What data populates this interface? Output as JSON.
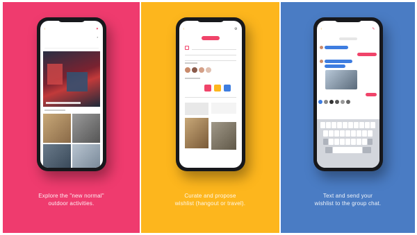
{
  "colors": {
    "panel_left": "#ef3b6e",
    "panel_middle": "#fdb61d",
    "panel_right": "#4a7cc4",
    "accent_pink": "#f0446a",
    "accent_blue": "#3e7de0"
  },
  "panels": [
    {
      "caption_line1": "Explore the \"new normal\"",
      "caption_line2": "outdoor activities."
    },
    {
      "caption_line1": "Curate and propose",
      "caption_line2": "wishlist (hangout or travel)."
    },
    {
      "caption_line1": "Text and send your",
      "caption_line2": "wishlist to the group chat."
    }
  ],
  "icons": [
    "back-icon",
    "heart-icon",
    "search-icon",
    "settings-icon"
  ]
}
